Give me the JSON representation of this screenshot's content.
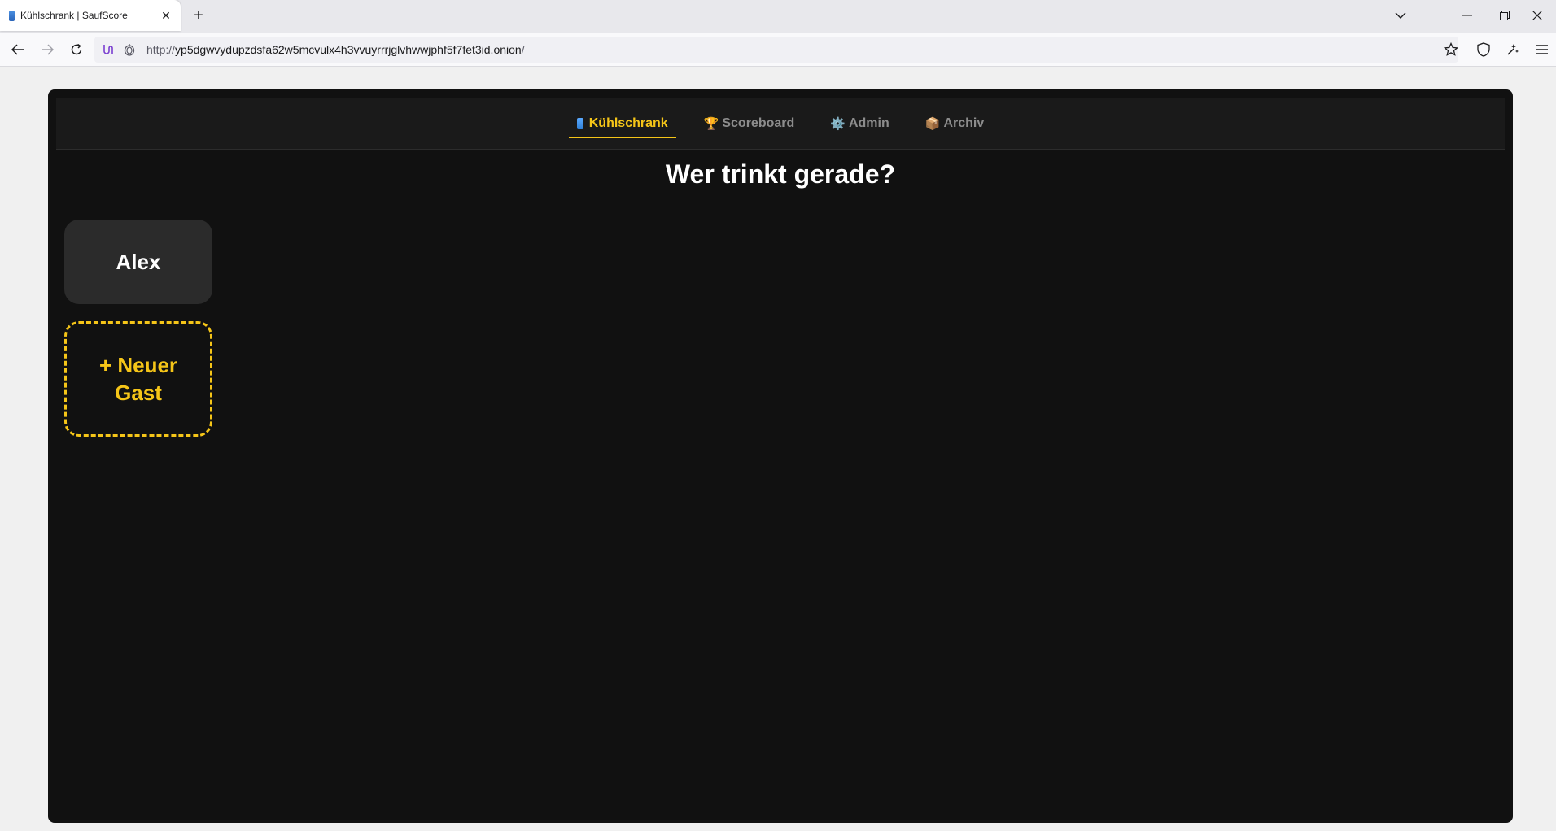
{
  "browser": {
    "tab_title": "Kühlschrank | SaufScore",
    "url_scheme": "http://",
    "url_host": "yp5dgwvydupzdsfa62w5mcvulx4h3vvuyrrrjglvhwwjphf5f7fet3id.onion",
    "url_path": "/"
  },
  "nav": {
    "items": [
      {
        "label": "Kühlschrank",
        "icon": "fridge-icon",
        "active": true
      },
      {
        "label": "Scoreboard",
        "icon": "🏆",
        "active": false
      },
      {
        "label": "Admin",
        "icon": "⚙️",
        "active": false
      },
      {
        "label": "Archiv",
        "icon": "📦",
        "active": false
      }
    ]
  },
  "main": {
    "title": "Wer trinkt gerade?",
    "guests": [
      "Alex"
    ],
    "new_guest_label": "+ Neuer Gast"
  },
  "colors": {
    "accent": "#f5c518",
    "background": "#111111",
    "card": "#2b2b2b"
  }
}
